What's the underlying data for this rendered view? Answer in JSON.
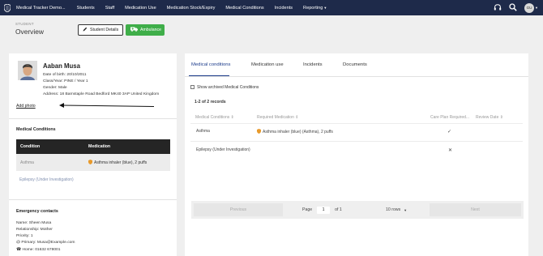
{
  "nav": {
    "brand": "Medical Tracker Demo...",
    "items": [
      "Students",
      "Staff",
      "Medication Use",
      "Medication Stock/Expiry",
      "Medical Conditions",
      "Incidents",
      "Reporting"
    ],
    "avatar_initials": "GU"
  },
  "header": {
    "subtitle": "STUDENT",
    "title": "Overview",
    "details_button": "Student Details",
    "ambulance_button": "Ambulance"
  },
  "student": {
    "name": "Aaban Musa",
    "dob": "Date of birth: 20/10/2011",
    "class_year": "Class/Year: PINE / Year 1",
    "gender": "Gender: Male",
    "address": "Address: 18 Barnstaple Road Bedford MK40 3AP United Kingdom",
    "add_photo": "Add photo"
  },
  "medical_conditions_panel": {
    "title": "Medical Conditions",
    "headers": [
      "Condition",
      "Medication"
    ],
    "rows": [
      {
        "condition": "Asthma",
        "medication": "Asthma inhaler (blue), 2 puffs"
      }
    ],
    "plain_item": "Epilepsy (Under Investigation)"
  },
  "emergency": {
    "title": "Emergency contacts",
    "name": "Name: Sheen Musa",
    "relationship": "Relationship: Mother",
    "priority": "Priority: 1",
    "email": "@ Primary: Musa@Example.com",
    "phone": "☎ Home: 01632 678001"
  },
  "tabs": [
    "Medical conditions",
    "Medication use",
    "Incidents",
    "Documents"
  ],
  "show_archived": "Show archived Medical Conditions",
  "records": "1-2 of 2 records",
  "table": {
    "headers": [
      "Medical Conditions ⇕",
      "Required Medication ⇕",
      "Care Plan Required...",
      "Review Date ⇕"
    ],
    "rows": [
      {
        "condition": "Asthma",
        "medication": "Asthma inhaler (blue) (Asthma), 2 puffs",
        "care_plan": "✓"
      },
      {
        "condition": "Epilepsy (Under Investigation)",
        "medication": "",
        "care_plan": "✕"
      }
    ]
  },
  "pager": {
    "previous": "Previous",
    "page_label": "Page",
    "page": "1",
    "of": "of 1",
    "rows": "10 rows",
    "next": "Next"
  },
  "colors": {
    "nav_bg": "#1e2a4a",
    "ambulance_green": "#3fae49",
    "active_tab": "#1a3a8a"
  }
}
